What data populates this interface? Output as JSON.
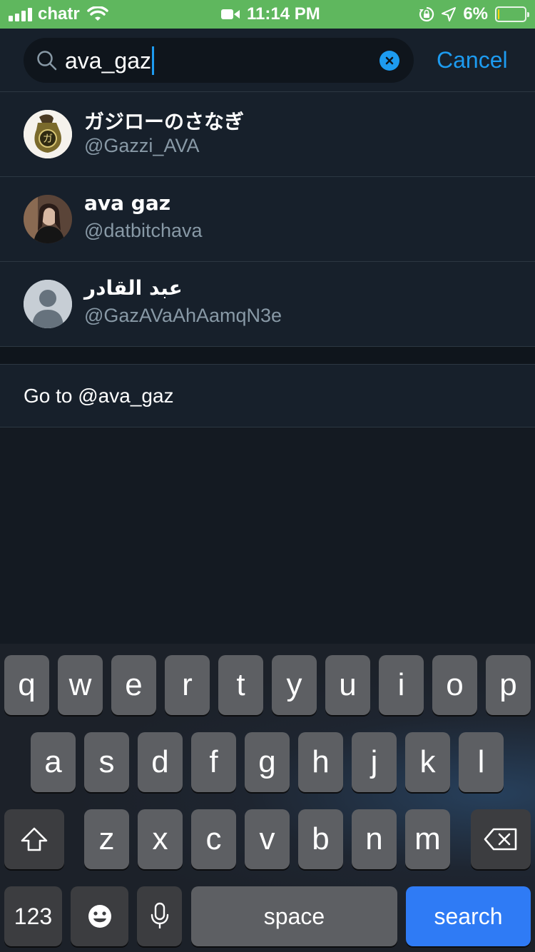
{
  "status_bar": {
    "carrier": "chatr",
    "time": "11:14 PM",
    "battery_percent": "6%",
    "battery_level": 0.06,
    "icons": [
      "signal-bars-icon",
      "wifi-icon",
      "video-recording-icon",
      "orientation-lock-icon",
      "location-arrow-icon",
      "battery-icon"
    ],
    "background_color": "#5fb75e"
  },
  "search": {
    "query": "ava_gaz",
    "cancel_label": "Cancel",
    "accent_color": "#1d9bf0"
  },
  "results": [
    {
      "name": "ガジローのさなぎ",
      "handle": "@Gazzi_AVA",
      "avatar": "coin-jar-avatar"
    },
    {
      "name": "ava gaz",
      "handle": "@datbitchava",
      "avatar": "photo-avatar"
    },
    {
      "name": "عبد القادر",
      "handle": "@GazAVaAhAamqN3e",
      "avatar": "default-avatar"
    }
  ],
  "goto": {
    "label": "Go to @ava_gaz"
  },
  "keyboard": {
    "row1": [
      "q",
      "w",
      "e",
      "r",
      "t",
      "y",
      "u",
      "i",
      "o",
      "p"
    ],
    "row2": [
      "a",
      "s",
      "d",
      "f",
      "g",
      "h",
      "j",
      "k",
      "l"
    ],
    "row3": [
      "z",
      "x",
      "c",
      "v",
      "b",
      "n",
      "m"
    ],
    "numbers_label": "123",
    "space_label": "space",
    "search_label": "search"
  }
}
